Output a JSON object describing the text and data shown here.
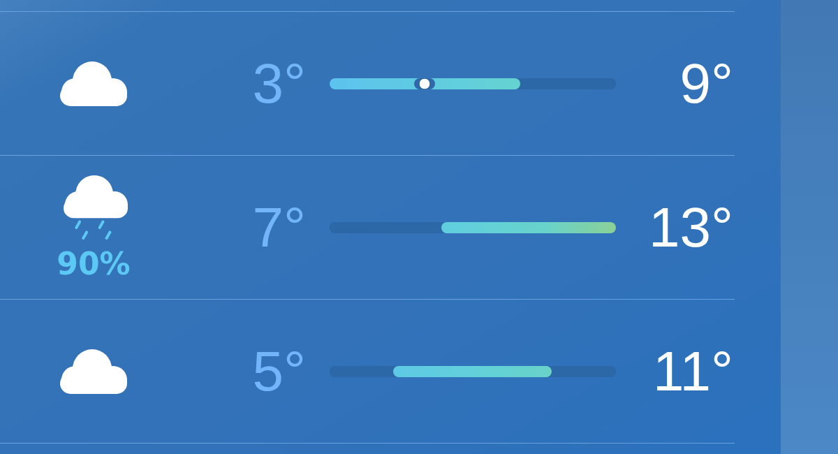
{
  "forecast": [
    {
      "kind": "cloud",
      "low": "3°",
      "range": {
        "empty_end": {
          "level": 0.334
        }
      },
      "current": {
        "level": 0.332
      },
      "high": "9°"
    },
    {
      "kind": "rain",
      "precipitation": "90%",
      "low": "7°",
      "range": {
        "empty_start": {
          "level": 0.39
        }
      },
      "high": "13°"
    },
    {
      "kind": "cloud",
      "low": "5°",
      "range": {
        "empty_start": {
          "level": 0.223
        },
        "empty_end": {
          "level": 0.224
        }
      },
      "high": "11°"
    }
  ]
}
